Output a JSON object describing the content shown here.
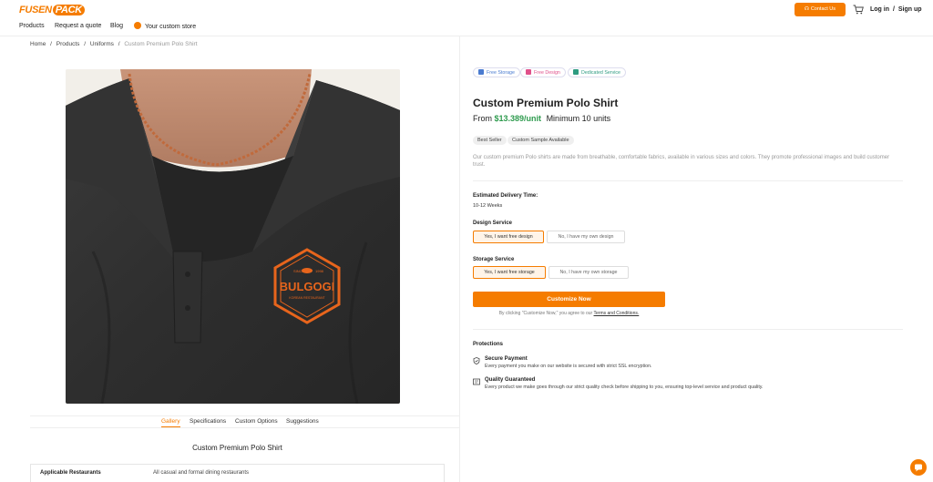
{
  "brand": {
    "name_part1": "FUSEN",
    "name_part2": "PACK",
    "accent": "#f57c00"
  },
  "nav": {
    "items": [
      "Products",
      "Request a quote",
      "Blog"
    ],
    "store_label": "Your custom store",
    "contact_label": "Contact Us",
    "login_label": "Log in",
    "signup_label": "Sign up",
    "sep": "/"
  },
  "breadcrumb": {
    "items": [
      "Home",
      "Products",
      "Uniforms"
    ],
    "current": "Custom Premium Polo Shirt",
    "sep": "/"
  },
  "gallery": {
    "logo_text": "BULGOGI",
    "logo_sub": "KOREAN RESTAURANT",
    "logo_since": "SINCE",
    "logo_year": "1998"
  },
  "tabs": [
    "Gallery",
    "Specifications",
    "Custom Options",
    "Suggestions"
  ],
  "section_title": "Custom Premium Polo Shirt",
  "specs": [
    {
      "key": "Applicable Restaurants",
      "value": "All casual and formal dining restaurants"
    }
  ],
  "badges": [
    {
      "label": "Free Storage",
      "color": "#4a7bd0"
    },
    {
      "label": "Free Design",
      "color": "#e0508a"
    },
    {
      "label": "Dedicated Service",
      "color": "#2e9b80"
    }
  ],
  "product": {
    "title": "Custom Premium Polo Shirt",
    "price_prefix": "From",
    "price": "$13.389/unit",
    "minimum": "Minimum 10 units",
    "tags": [
      "Best Seller",
      "Custom Sample Available"
    ],
    "description": "Our custom premium Polo shirts are made from breathable, comfortable fabrics, available in various sizes and colors. They promote professional images and build customer trust."
  },
  "delivery": {
    "label": "Estimated Delivery Time:",
    "value": "10-12 Weeks"
  },
  "design_service": {
    "label": "Design Service",
    "options": [
      "Yes, I want free design",
      "No, I have my own design"
    ],
    "selected": 0
  },
  "storage_service": {
    "label": "Storage Service",
    "options": [
      "Yes, I want free storage",
      "No, I have my own storage"
    ],
    "selected": 0
  },
  "cta": {
    "label": "Customize Now",
    "agree_prefix": "By clicking \"Customize Now,\" you agree to our",
    "terms_link": "Terms and Conditions."
  },
  "protections": {
    "title": "Protections",
    "items": [
      {
        "title": "Secure Payment",
        "desc": "Every payment you make on our website is secured with strict SSL encryption.",
        "icon": "shield-icon"
      },
      {
        "title": "Quality Guaranteed",
        "desc": "Every product we make goes through our strict quality check before shipping to you, ensuring top-level service and product quality.",
        "icon": "certificate-icon"
      }
    ]
  }
}
